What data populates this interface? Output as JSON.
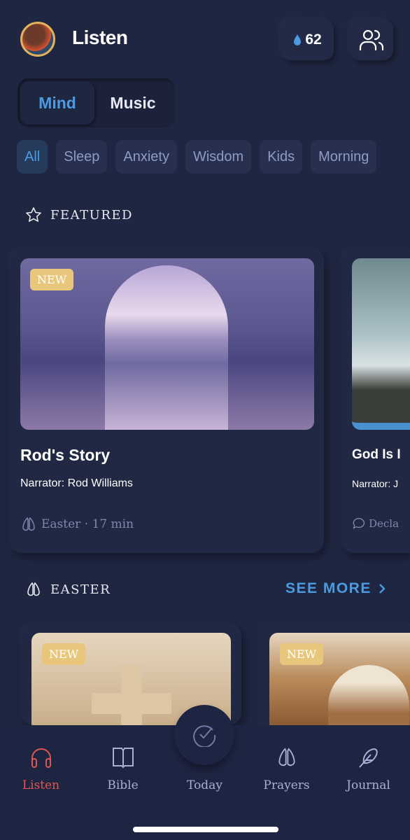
{
  "header": {
    "title": "Listen",
    "streak_count": "62",
    "streak_icon": "water-drop-icon",
    "friends_icon": "users-icon"
  },
  "segment": {
    "items": [
      "Mind",
      "Music"
    ],
    "selected": "Mind"
  },
  "chips": {
    "items": [
      "All",
      "Sleep",
      "Anxiety",
      "Wisdom",
      "Kids",
      "Morning"
    ],
    "selected": "All"
  },
  "featured": {
    "heading": "FEATURED",
    "cards": [
      {
        "badge": "NEW",
        "title": "Rod's Story",
        "narrator": "Narrator: Rod Williams",
        "meta": "Easter · 17 min",
        "meta_icon": "praying-hands-icon"
      },
      {
        "title": "God Is I",
        "narrator": "Narrator: J",
        "meta": "Decla",
        "meta_icon": "chat-bubble-icon"
      }
    ]
  },
  "easter": {
    "heading": "EASTER",
    "see_more": "SEE MORE",
    "cards": [
      {
        "badge": "NEW"
      },
      {
        "badge": "NEW"
      }
    ]
  },
  "nav": {
    "items": [
      {
        "label": "Listen",
        "icon": "headphones-icon"
      },
      {
        "label": "Bible",
        "icon": "book-icon"
      },
      {
        "label": "Today",
        "icon": "check-circle-icon"
      },
      {
        "label": "Prayers",
        "icon": "praying-hands-icon"
      },
      {
        "label": "Journal",
        "icon": "feather-icon"
      }
    ],
    "active": "Listen"
  },
  "colors": {
    "accent": "#4a9be0",
    "active_nav": "#e0574f",
    "background": "#1f2641",
    "badge": "#e8c77c"
  }
}
